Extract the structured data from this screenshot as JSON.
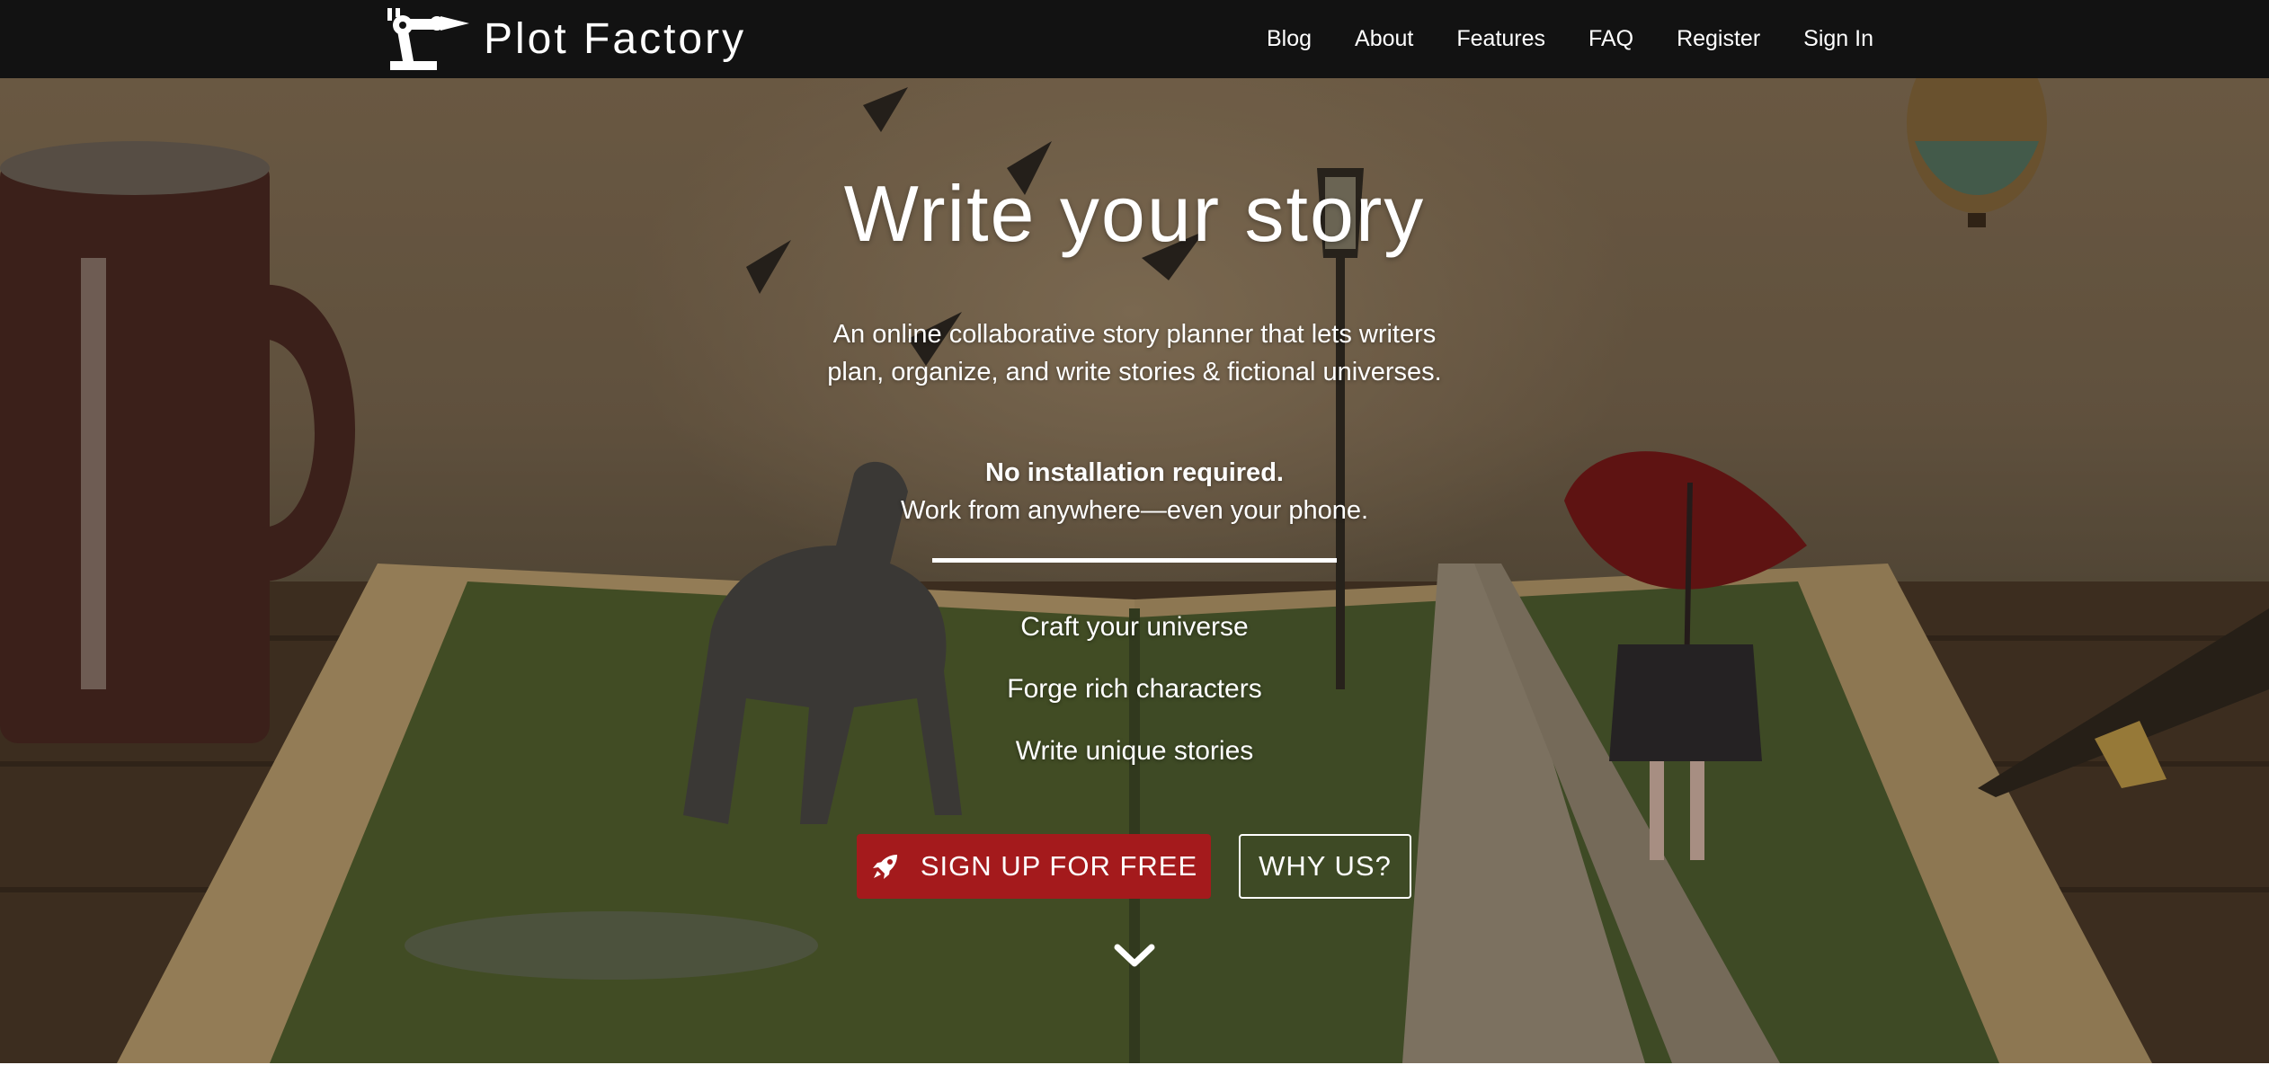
{
  "nav": {
    "brand": "Plot Factory",
    "links": [
      "Blog",
      "About",
      "Features",
      "FAQ",
      "Register",
      "Sign In"
    ]
  },
  "hero": {
    "title": "Write your story",
    "subtitle": "An online collaborative story planner that lets writers plan, organize, and write stories & fictional universes.",
    "note_bold": "No installation required.",
    "note": "Work from anywhere—even your phone.",
    "features": [
      "Craft your universe",
      "Forge rich characters",
      "Write unique stories"
    ],
    "cta_primary": "SIGN UP FOR FREE",
    "cta_secondary": "WHY US?"
  },
  "icons": {
    "logo": "robot-arm-pen-icon",
    "cta_primary": "rocket-icon",
    "scroll": "chevron-down-icon"
  },
  "colors": {
    "navbar": "#121212",
    "primary_button": "#a41a1c",
    "text": "#ffffff"
  }
}
